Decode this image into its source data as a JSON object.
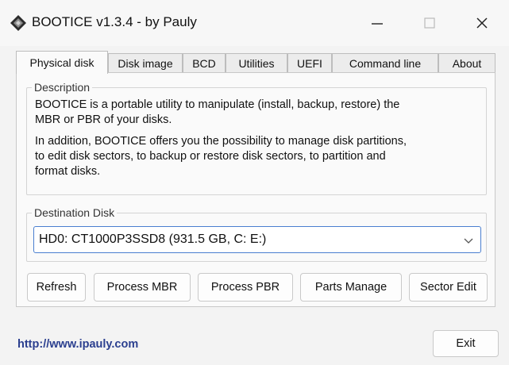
{
  "window": {
    "title": "BOOTICE v1.3.4 - by Pauly",
    "minimize_glyph": "—",
    "close_glyph": "✕"
  },
  "tabs": [
    {
      "label": "Physical disk",
      "active": true
    },
    {
      "label": "Disk image",
      "active": false
    },
    {
      "label": "BCD",
      "active": false
    },
    {
      "label": "Utilities",
      "active": false
    },
    {
      "label": "UEFI",
      "active": false
    },
    {
      "label": "Command line",
      "active": false
    },
    {
      "label": "About",
      "active": false
    }
  ],
  "description": {
    "label": "Description",
    "para1_line1": "BOOTICE is a portable utility to manipulate (install, backup, restore) the",
    "para1_line2": "MBR or PBR of your disks.",
    "para2_line1": "In addition, BOOTICE offers you the possibility to manage disk partitions,",
    "para2_line2": "to edit disk sectors, to backup or restore disk sectors, to partition and",
    "para2_line3": "format disks."
  },
  "destination": {
    "label": "Destination Disk",
    "selected": "HD0: CT1000P3SSD8 (931.5 GB, C: E:)"
  },
  "buttons": {
    "refresh": "Refresh",
    "process_mbr": "Process MBR",
    "process_pbr": "Process PBR",
    "parts_manage": "Parts Manage",
    "sector_edit": "Sector Edit",
    "exit": "Exit"
  },
  "footer": {
    "link": "http://www.ipauly.com"
  },
  "colors": {
    "accent": "#4a7fd0",
    "link": "#2b3f8f"
  }
}
